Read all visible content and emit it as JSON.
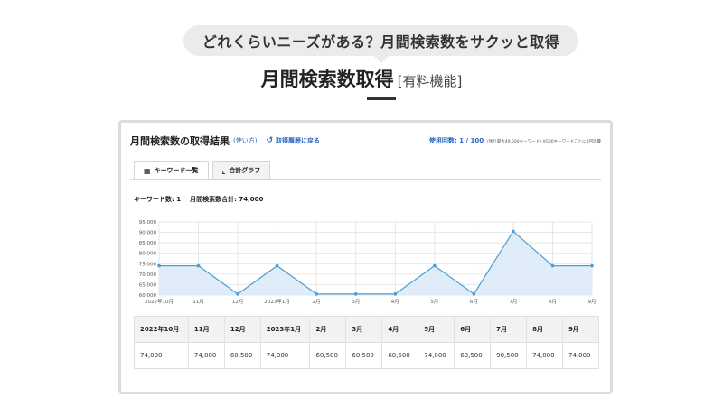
{
  "promo": {
    "bubble_text": "どれくらいニーズがある？月間検索数をサクッと取得",
    "headline": "月間検索数取得",
    "headline_tag": "[有料機能]"
  },
  "panel": {
    "title": "月間検索数の取得結果",
    "howto_label": "(使い方)",
    "back_icon": "undo-icon",
    "back_label": "取得履歴に戻る",
    "usage_count": "使用回数: 1 / 100",
    "usage_note": "(残り最大49,500キーワード)  ※500キーワードごとに1回消費"
  },
  "tabs": [
    {
      "label": "キーワード一覧",
      "icon": "table-icon",
      "active": true
    },
    {
      "label": "合計グラフ",
      "icon": "chart-icon",
      "active": false
    }
  ],
  "summary": {
    "keyword_count": "キーワード数: 1",
    "monthly_total": "月間検索数合計: 74,000"
  },
  "chart_data": {
    "type": "area",
    "categories": [
      "2022年10月",
      "11月",
      "12月",
      "2023年1月",
      "2月",
      "3月",
      "4月",
      "5月",
      "6月",
      "7月",
      "8月",
      "9月"
    ],
    "values": [
      74000,
      74000,
      60500,
      74000,
      60500,
      60500,
      60500,
      74000,
      60500,
      90500,
      74000,
      74000
    ],
    "ylim": [
      60000,
      95000
    ],
    "yticks": [
      "60,000",
      "65,000",
      "70,000",
      "75,000",
      "80,000",
      "85,000",
      "90,000",
      "95,000"
    ],
    "ytick_values": [
      60000,
      65000,
      70000,
      75000,
      80000,
      85000,
      90000,
      95000
    ],
    "grid": true,
    "line_color": "#4a9fd4",
    "fill_color": "#dbeaf8"
  },
  "table": {
    "headers": [
      "2022年10月",
      "11月",
      "12月",
      "2023年1月",
      "2月",
      "3月",
      "4月",
      "5月",
      "6月",
      "7月",
      "8月",
      "9月"
    ],
    "values": [
      "74,000",
      "74,000",
      "60,500",
      "74,000",
      "60,500",
      "60,500",
      "60,500",
      "74,000",
      "60,500",
      "90,500",
      "74,000",
      "74,000"
    ]
  }
}
